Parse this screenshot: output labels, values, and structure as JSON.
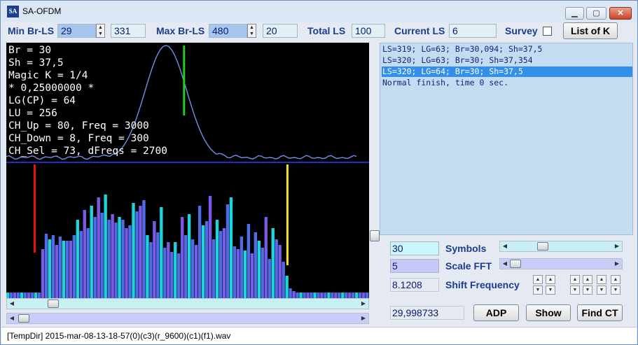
{
  "window": {
    "title": "SA-OFDM",
    "icon_label": "SA",
    "min_label": "▁",
    "max_label": "▢",
    "close_label": "✕"
  },
  "toolbar": {
    "min_br_ls_label": "Min Br-LS",
    "min_br_ls_value": "29",
    "min_br_ls_extra": "331",
    "max_br_ls_label": "Max Br-LS",
    "max_br_ls_value": "480",
    "max_br_ls_extra": "20",
    "total_ls_label": "Total LS",
    "total_ls_value": "100",
    "current_ls_label": "Current LS",
    "current_ls_value": "6",
    "survey_label": "Survey",
    "survey_checked": false,
    "list_of_k_label": "List of K"
  },
  "overlay_lines": [
    "Br = 30",
    "Sh = 37,5",
    "Magic K = 1/4",
    "* 0,25000000 *",
    "LG(CP) = 64",
    "LU = 256",
    "CH_Up = 80, Freq = 3000",
    "CH_Down = 8, Freq = 300",
    "CH_Sel = 73, dFreqs = 2700"
  ],
  "log": [
    {
      "text": "LS=319; LG=63; Br=30,094; Sh=37,5",
      "selected": false
    },
    {
      "text": "LS=320; LG=63; Br=30; Sh=37,354",
      "selected": false
    },
    {
      "text": "LS=320; LG=64; Br=30; Sh=37,5",
      "selected": true
    },
    {
      "text": "Normal finish, time 0 sec.",
      "selected": false
    }
  ],
  "controls": {
    "symbols_value": "30",
    "symbols_label": "Symbols",
    "symbols_level": 0.3,
    "scale_fft_value": "5",
    "scale_fft_label": "Scale FFT",
    "scale_fft_level": 0.0,
    "shift_value": "8.1208",
    "shift_label": "Shift Frequency",
    "freq_value": "29,998733",
    "adp_label": "ADP",
    "show_label": "Show",
    "find_ct_label": "Find CT"
  },
  "status": {
    "path": "[TempDir] 2015-mar-08-13-18-57(0)(c3)(r_9600)(c1)(f1).wav"
  },
  "colors": {
    "curve": "#6f90e6",
    "baseline": "#1e2dbf",
    "marker_green": "#22cc22",
    "marker_red": "#ee1111",
    "marker_yellow": "#f5e11a",
    "bar_cyan": "#1ed3d9",
    "bar_blue": "#4c6ce8",
    "bar_purple": "#7a5ae6"
  },
  "spectrum": {
    "curve_peak_symbol": 0.44,
    "green_marker_symbol": 0.49,
    "red_marker_bin": 0.078,
    "yellow_marker_bin": 0.775,
    "heights": [
      0.04,
      0.04,
      0.04,
      0.04,
      0.04,
      0.04,
      0.04,
      0.04,
      0.04,
      0.04,
      0.35,
      0.46,
      0.42,
      0.45,
      0.38,
      0.44,
      0.41,
      0.41,
      0.41,
      0.45,
      0.56,
      0.48,
      0.63,
      0.5,
      0.66,
      0.58,
      0.72,
      0.61,
      0.74,
      0.56,
      0.6,
      0.54,
      0.58,
      0.56,
      0.5,
      0.52,
      0.68,
      0.62,
      0.66,
      0.7,
      0.45,
      0.4,
      0.55,
      0.47,
      0.65,
      0.36,
      0.4,
      0.33,
      0.4,
      0.32,
      0.58,
      0.45,
      0.6,
      0.42,
      0.38,
      0.66,
      0.52,
      0.55,
      0.73,
      0.42,
      0.56,
      0.48,
      0.5,
      0.67,
      0.72,
      0.37,
      0.35,
      0.44,
      0.34,
      0.53,
      0.32,
      0.47,
      0.41,
      0.36,
      0.58,
      0.28,
      0.5,
      0.42,
      0.38,
      0.26,
      0.16,
      0.07,
      0.05,
      0.04,
      0.04,
      0.04,
      0.04,
      0.04,
      0.04,
      0.04,
      0.04,
      0.04,
      0.04,
      0.04,
      0.04,
      0.04,
      0.04,
      0.04,
      0.04,
      0.04,
      0.04,
      0.04,
      0.04,
      0.04
    ]
  }
}
